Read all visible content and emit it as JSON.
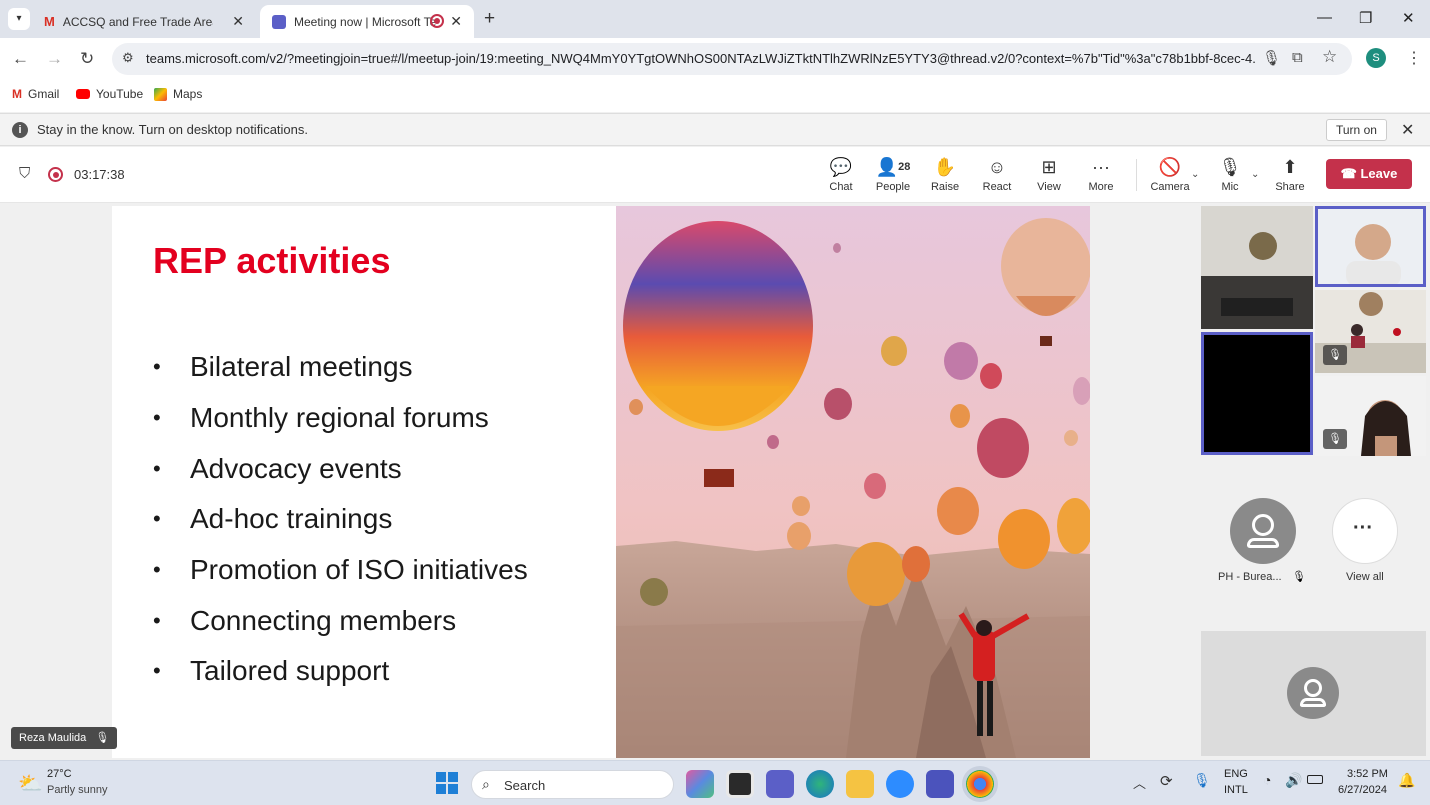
{
  "browser": {
    "tabs": [
      {
        "title": "ACCSQ and Free Trade Area/Di"
      },
      {
        "title": "Meeting now | Microsoft Te"
      }
    ],
    "url": "teams.microsoft.com/v2/?meetingjoin=true#/l/meetup-join/19:meeting_NWQ4MmY0YTgtOWNhOS00NTAzLWJiZTktNTlhZWRlNzE5YTY3@thread.v2/0?context=%7b\"Tid\"%3a\"c78b1bbf-8cec-4...",
    "profile_initial": "S",
    "bookmarks": [
      {
        "label": "Gmail"
      },
      {
        "label": "YouTube"
      },
      {
        "label": "Maps"
      }
    ]
  },
  "notification": {
    "text": "Stay in the know. Turn on desktop notifications.",
    "button": "Turn on"
  },
  "meeting": {
    "timer": "03:17:38",
    "people_count": "28",
    "controls": {
      "chat": "Chat",
      "people": "People",
      "raise": "Raise",
      "react": "React",
      "view": "View",
      "more": "More",
      "camera": "Camera",
      "mic": "Mic",
      "share": "Share",
      "leave": "Leave"
    },
    "presenter_name": "Reza Maulida",
    "participant_name": "PH - Burea...",
    "view_all": "View all"
  },
  "slide": {
    "title": "REP activities",
    "bullets": [
      "Bilateral meetings",
      "Monthly regional forums",
      "Advocacy events",
      "Ad-hoc trainings",
      "Promotion of ISO initiatives",
      "Connecting members",
      "Tailored support"
    ]
  },
  "taskbar": {
    "weather_temp": "27°C",
    "weather_desc": "Partly sunny",
    "search": "Search",
    "lang1": "ENG",
    "lang2": "INTL",
    "time": "3:52 PM",
    "date": "6/27/2024"
  },
  "colors": {
    "accent_red": "#e3001f",
    "leave_red": "#c4314b",
    "active_tile_border": "#5b5fc7"
  }
}
